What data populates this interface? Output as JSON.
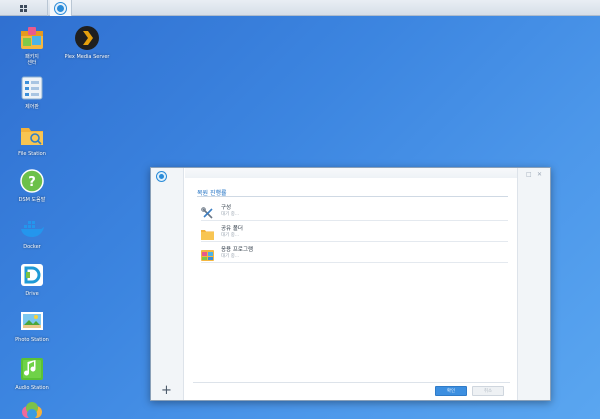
{
  "taskbar": {
    "main_menu_icon": "grid-icon",
    "open_app_icon": "package-center-icon"
  },
  "desktop": {
    "icons": [
      {
        "label": "패키지\n센터",
        "icon": "package-center-icon"
      },
      {
        "label": "제어판",
        "icon": "control-panel-icon"
      },
      {
        "label": "File Station",
        "icon": "folder-icon"
      },
      {
        "label": "DSM 도움말",
        "icon": "help-icon"
      },
      {
        "label": "Docker",
        "icon": "docker-icon"
      },
      {
        "label": "Drive",
        "icon": "drive-icon"
      },
      {
        "label": "Photo Station",
        "icon": "photo-icon"
      },
      {
        "label": "Audio Station",
        "icon": "audio-icon"
      },
      {
        "label": "Plex Media Server",
        "icon": "plex-icon"
      }
    ]
  },
  "window": {
    "section_title": "복원 진행률",
    "tasks": [
      {
        "name": "구성",
        "status": "대기 중...",
        "icon": "tools-icon"
      },
      {
        "name": "공유 폴더",
        "status": "대기 중...",
        "icon": "shared-folder-icon"
      },
      {
        "name": "응용 프로그램",
        "status": "대기 중...",
        "icon": "applications-icon"
      }
    ],
    "ok_label": "확인",
    "cancel_label": "취소",
    "add_label": "+"
  },
  "colors": {
    "desktop_bg": "#3c85e0",
    "accent": "#1a6dc2",
    "ok_button": "#3d8fe0"
  }
}
